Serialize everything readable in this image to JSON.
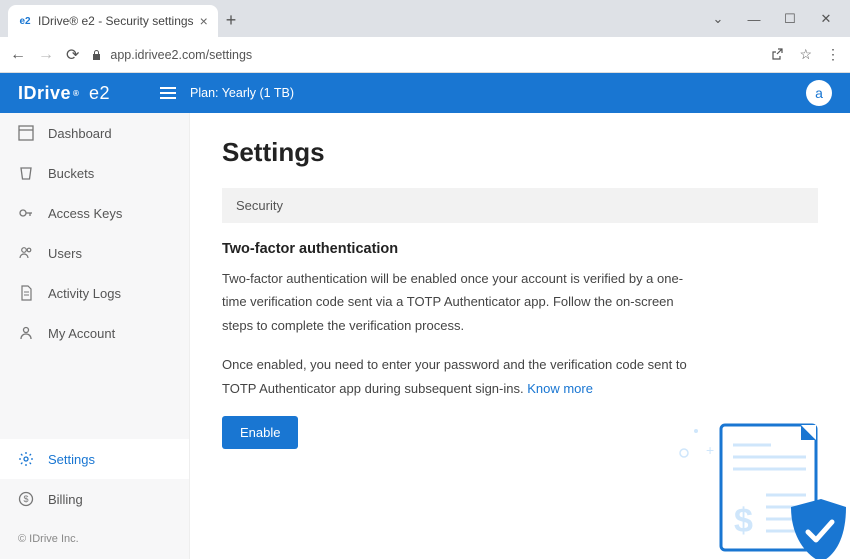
{
  "browser": {
    "tab_title": "IDrive® e2 - Security settings",
    "url": "app.idrivee2.com/settings"
  },
  "header": {
    "brand": "IDrive",
    "brand_suffix": "e2",
    "plan": "Plan: Yearly (1 TB)",
    "avatar_initial": "a"
  },
  "sidebar": {
    "items": [
      {
        "label": "Dashboard"
      },
      {
        "label": "Buckets"
      },
      {
        "label": "Access Keys"
      },
      {
        "label": "Users"
      },
      {
        "label": "Activity Logs"
      },
      {
        "label": "My Account"
      }
    ],
    "bottom_items": [
      {
        "label": "Settings"
      },
      {
        "label": "Billing"
      }
    ],
    "copyright": "© IDrive Inc."
  },
  "content": {
    "page_title": "Settings",
    "section": "Security",
    "tfa_title": "Two-factor authentication",
    "tfa_para1": "Two-factor authentication will be enabled once your account is verified by a one-time verification code sent via a TOTP Authenticator app. Follow the on-screen steps to complete the verification process.",
    "tfa_para2_a": "Once enabled, you need to enter your password and the verification code sent to TOTP Authenticator app during subsequent sign-ins. ",
    "tfa_link": "Know more",
    "enable_btn": "Enable"
  }
}
